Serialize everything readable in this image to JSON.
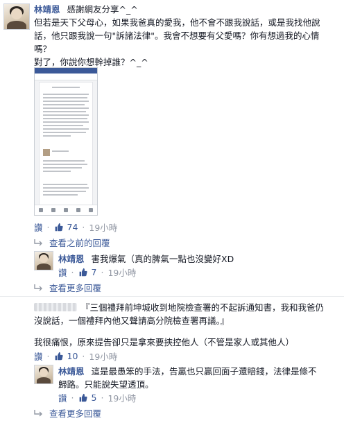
{
  "main_comment": {
    "author": "林靖恩",
    "text_lines": [
      "感謝網友分享^_^",
      "但若是天下父母心，如果我爸真的愛我，他不會不跟我說話，或是我找他說",
      "話，他只跟我說一句\"訴諸法律\"。我會不想要有父愛嗎？你有想過我的心情",
      "嗎？",
      "對了，你說你想幹掉誰？^_^"
    ],
    "like_label": "讚",
    "like_count": "74",
    "time": "19小時"
  },
  "previous_replies_label": "查看之前的回覆",
  "reply1": {
    "author": "林靖恩",
    "text": "害我爆氣（真的脾氣一點也沒變好XD",
    "like_label": "讚",
    "like_count": "7",
    "time": "19小時"
  },
  "more_replies_1": "查看更多回覆",
  "comment2": {
    "text_line1": "『三個禮拜前坤城收到地院檢查署的不起訴通知書，我和我爸仍",
    "text_line2": "沒說話，一個禮拜內他又聲請高分院檢查署再議。』",
    "line3": "我很痛恨，原來提告卻只是拿來要挾控他人（不管是家人或其他人）",
    "like_label": "讚",
    "like_count": "10",
    "time": "19小時"
  },
  "reply2": {
    "author": "林靖恩",
    "text_line1": "這是最愚笨的手法，告贏也只贏回面子還賠錢，法律是條不",
    "text_line2": "歸路。只能說失望透頂。",
    "like_label": "讚",
    "like_count": "5",
    "time": "19小時"
  },
  "more_replies_2": "查看更多回覆",
  "colors": {
    "name": "#3b5998",
    "link": "#3b5998",
    "muted": "#9197a3",
    "text": "#141823"
  },
  "icons": [
    "avatar",
    "thumbs-up-icon",
    "reply-arrow-icon",
    "phone-screenshot"
  ]
}
